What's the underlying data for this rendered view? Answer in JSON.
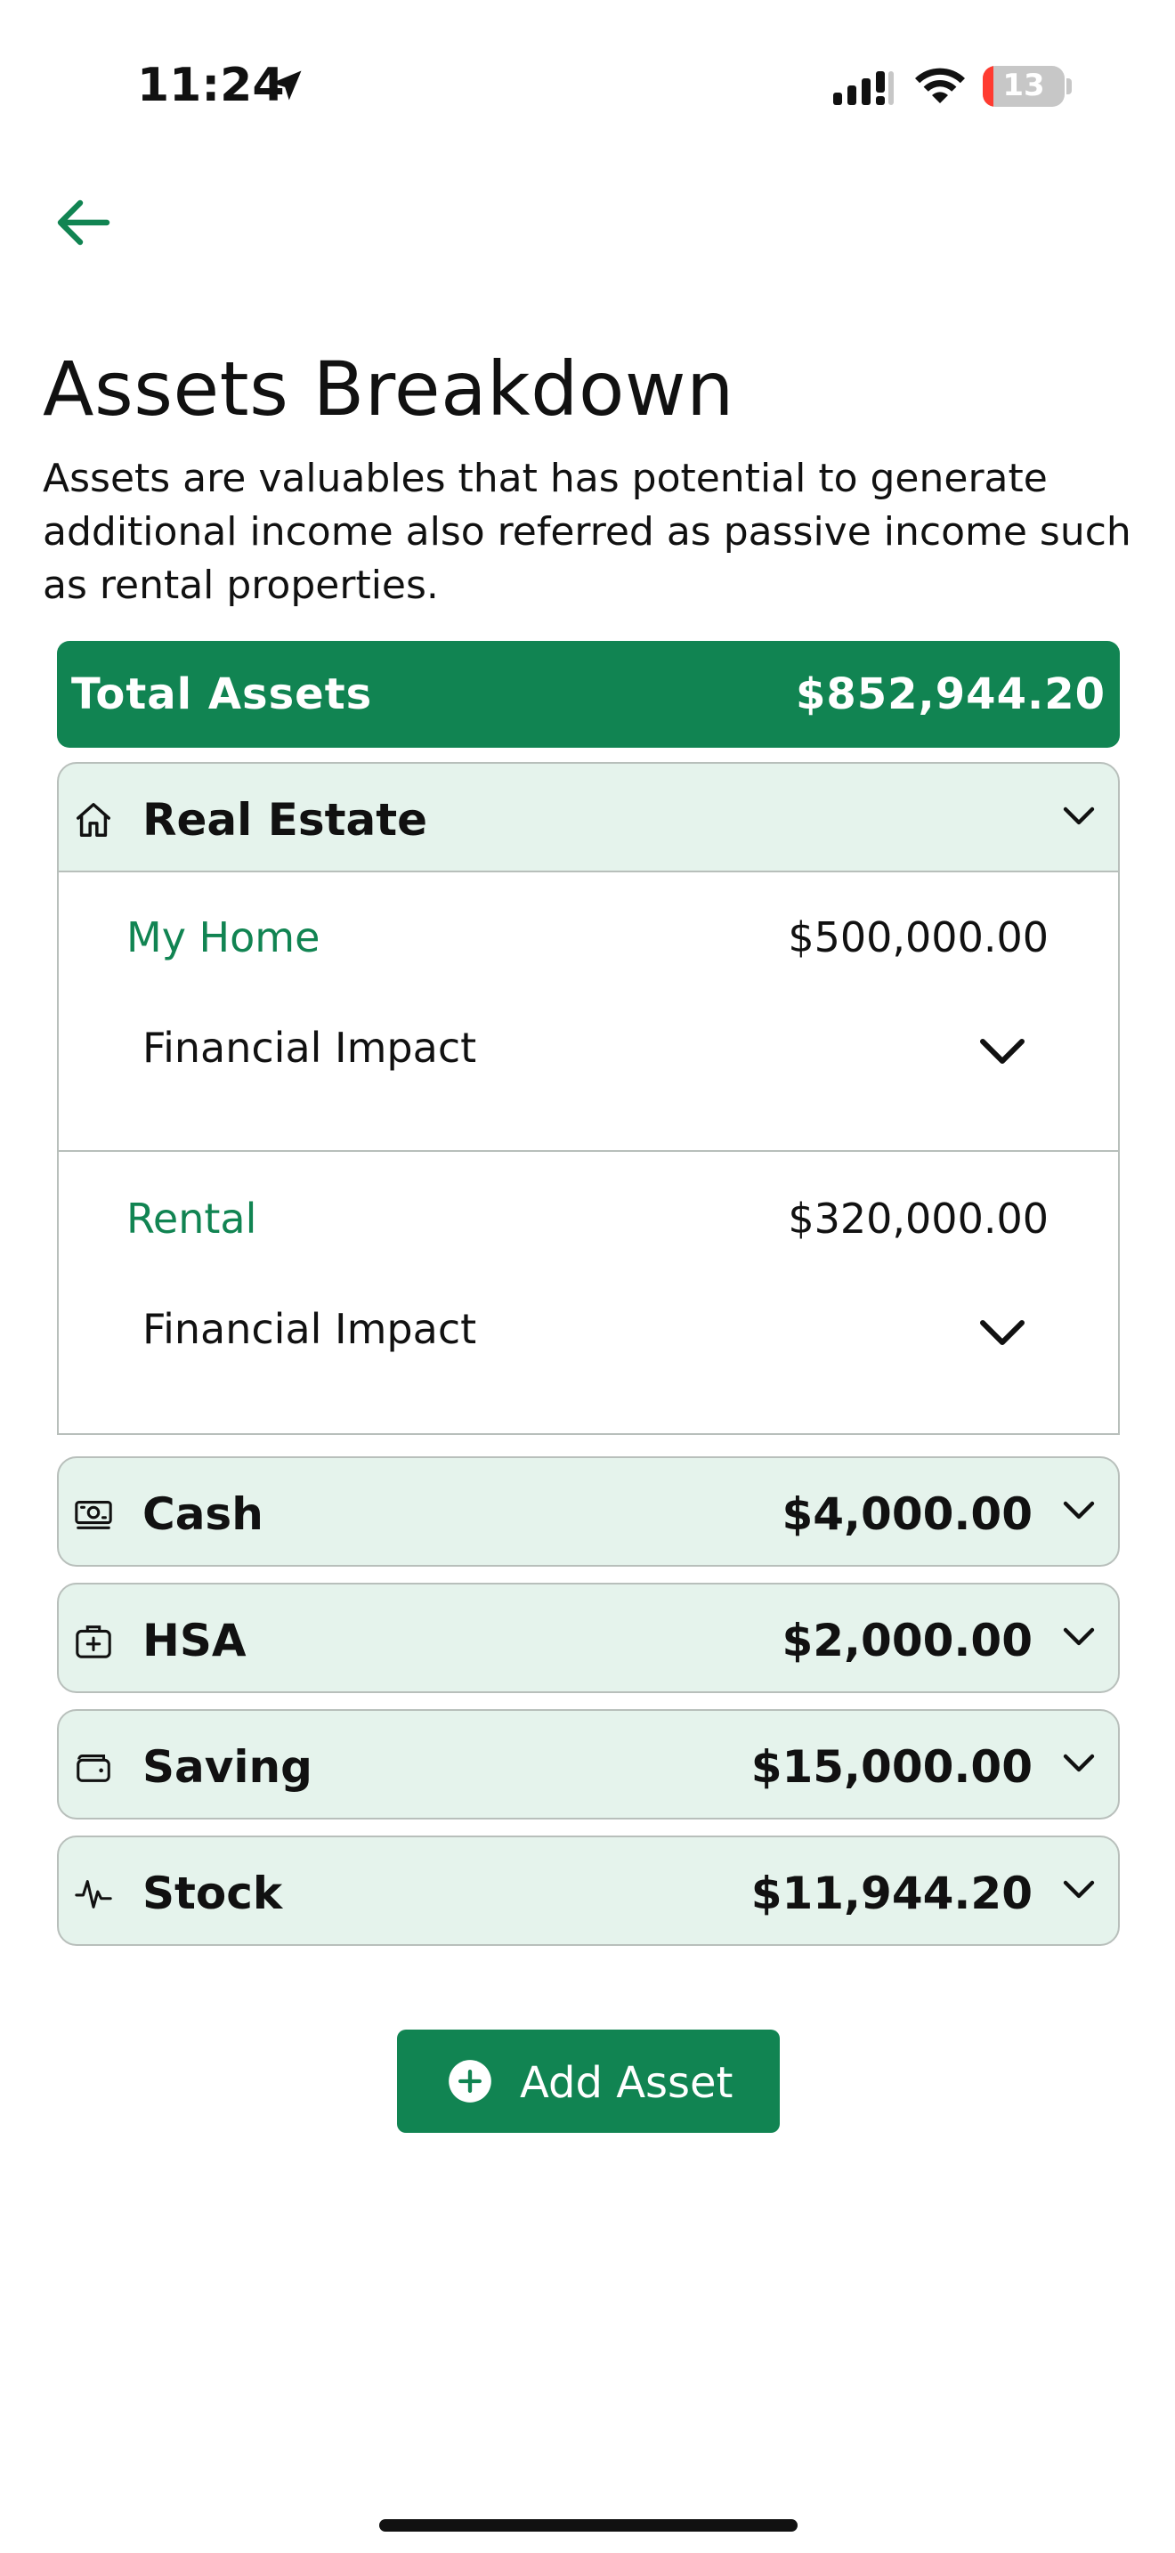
{
  "status_bar": {
    "time": "11:24",
    "battery_level": "13",
    "battery_fraction": 0.13,
    "icons": [
      "location-arrow-icon",
      "cellular-signal-icon",
      "wifi-icon",
      "battery-icon"
    ]
  },
  "header": {
    "back_icon": "arrow-left-icon",
    "title": "Assets Breakdown",
    "description": "Assets are valuables that has potential to generate additional income also referred as passive income such as rental properties."
  },
  "total": {
    "label": "Total Assets",
    "value": "$852,944.20"
  },
  "categories": {
    "real_estate": {
      "label": "Real Estate",
      "icon": "house-icon",
      "expanded": true,
      "items": [
        {
          "name": "My Home",
          "value": "$500,000.00",
          "impact_label": "Financial Impact"
        },
        {
          "name": "Rental",
          "value": "$320,000.00",
          "impact_label": "Financial Impact"
        }
      ]
    },
    "cash": {
      "label": "Cash",
      "value": "$4,000.00",
      "icon": "banknote-icon"
    },
    "hsa": {
      "label": "HSA",
      "value": "$2,000.00",
      "icon": "medical-kit-icon"
    },
    "saving": {
      "label": "Saving",
      "value": "$15,000.00",
      "icon": "wallet-icon"
    },
    "stock": {
      "label": "Stock",
      "value": "$11,944.20",
      "icon": "pulse-chart-icon"
    }
  },
  "actions": {
    "add_asset_label": "Add Asset",
    "add_icon": "plus-circle-icon"
  },
  "colors": {
    "accent": "#118452",
    "panel_bg": "#e5f3ec",
    "border": "#b8bfbb",
    "battery_low": "#ff3b30"
  }
}
